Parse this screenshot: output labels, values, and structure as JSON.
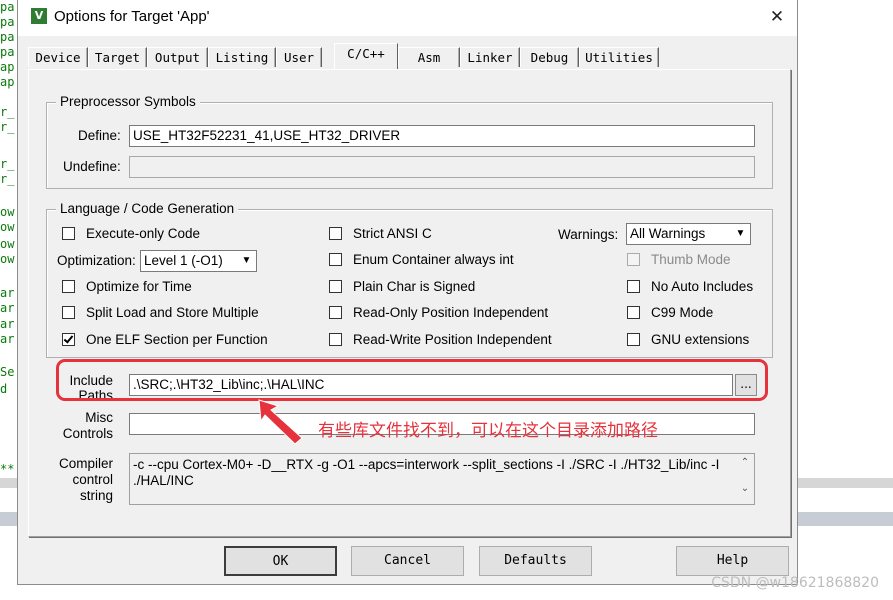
{
  "window": {
    "title": "Options for Target 'App'",
    "close_glyph": "✕"
  },
  "tabs": [
    {
      "label": "Device"
    },
    {
      "label": "Target"
    },
    {
      "label": "Output"
    },
    {
      "label": "Listing"
    },
    {
      "label": "User"
    },
    {
      "label": "C/C++"
    },
    {
      "label": "Asm"
    },
    {
      "label": "Linker"
    },
    {
      "label": "Debug"
    },
    {
      "label": "Utilities"
    }
  ],
  "active_tab": "C/C++",
  "preprocessor": {
    "title": "Preprocessor Symbols",
    "define_label": "Define:",
    "define_value": "USE_HT32F52231_41,USE_HT32_DRIVER",
    "undefine_label": "Undefine:",
    "undefine_value": ""
  },
  "language": {
    "title": "Language / Code Generation",
    "optimization_label": "Optimization:",
    "optimization_value": "Level 1 (-O1)",
    "warnings_label": "Warnings:",
    "warnings_value": "All Warnings",
    "checkboxes": {
      "execute_only": {
        "label": "Execute-only Code",
        "checked": false
      },
      "optimize_time": {
        "label": "Optimize for Time",
        "checked": false
      },
      "split_load": {
        "label": "Split Load and Store Multiple",
        "checked": false
      },
      "one_elf": {
        "label": "One ELF Section per Function",
        "checked": true
      },
      "strict_ansi": {
        "label": "Strict ANSI C",
        "checked": false
      },
      "enum_container": {
        "label": "Enum Container always int",
        "checked": false
      },
      "plain_char": {
        "label": "Plain Char is Signed",
        "checked": false
      },
      "read_only": {
        "label": "Read-Only Position Independent",
        "checked": false
      },
      "read_write": {
        "label": "Read-Write Position Independent",
        "checked": false
      },
      "thumb_mode": {
        "label": "Thumb Mode",
        "checked": false,
        "disabled": true
      },
      "no_auto_includes": {
        "label": "No Auto Includes",
        "checked": false
      },
      "c99_mode": {
        "label": "C99 Mode",
        "checked": false
      },
      "gnu_extensions": {
        "label": "GNU extensions",
        "checked": false
      }
    }
  },
  "include": {
    "label_line1": "Include",
    "label_line2": "Paths",
    "value": ".\\SRC;.\\HT32_Lib\\inc;.\\HAL\\INC",
    "browse_label": "..."
  },
  "misc": {
    "label_line1": "Misc",
    "label_line2": "Controls",
    "value": ""
  },
  "compiler": {
    "label_line1": "Compiler",
    "label_line2": "control",
    "label_line3": "string",
    "value": "-c --cpu Cortex-M0+ -D__RTX -g -O1 --apcs=interwork --split_sections -I ./SRC -I ./HT32_Lib/inc -I ./HAL/INC"
  },
  "buttons": {
    "ok": "OK",
    "cancel": "Cancel",
    "defaults": "Defaults",
    "help": "Help"
  },
  "annotation": {
    "text": "有些库文件找不到，可以在这个目录添加路径",
    "color": "#e6323c"
  },
  "watermark": "CSDN @w18621868820",
  "background_code": [
    "pa",
    "pa",
    "pa",
    "pa",
    "ap",
    "ap",
    "r_",
    "r_",
    "r_",
    "r_",
    "ow",
    "ow",
    "ow",
    "ow",
    "ar",
    "ar",
    "ar",
    "ar",
    "Se",
    "d",
    "**"
  ]
}
